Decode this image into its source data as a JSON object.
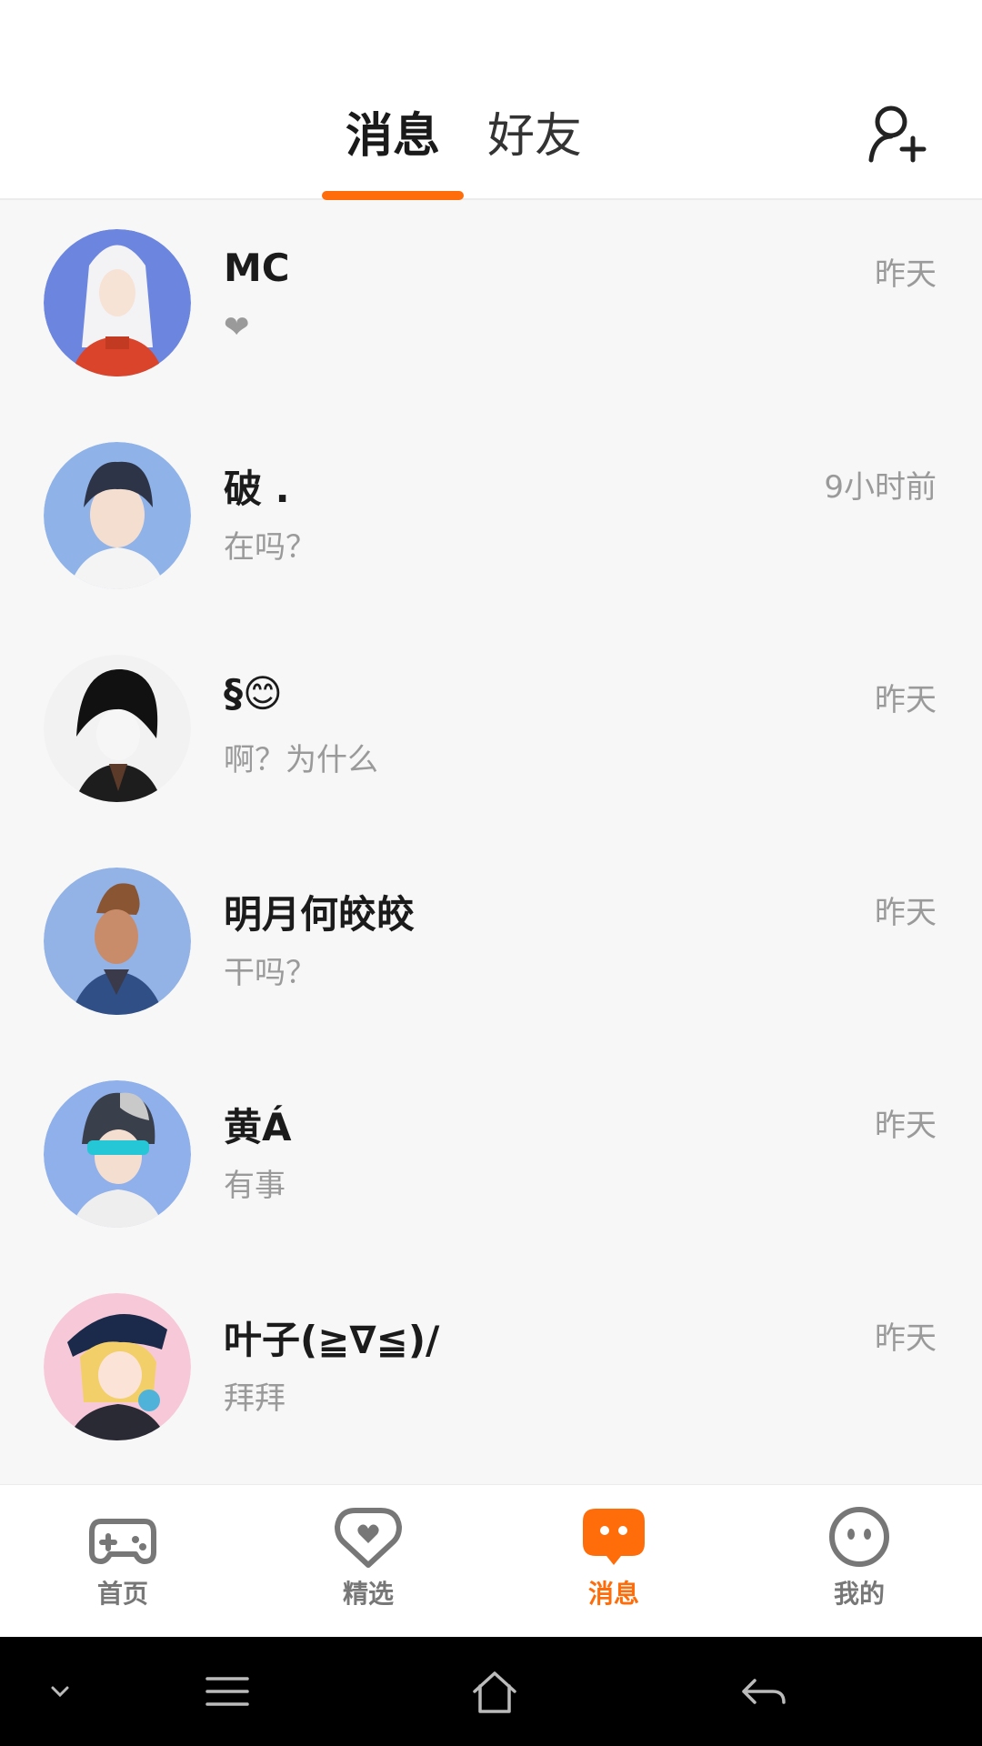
{
  "header": {
    "tabs": [
      {
        "label": "消息",
        "active": true
      },
      {
        "label": "好友",
        "active": false
      }
    ],
    "add_friend_icon": "add-person-icon"
  },
  "conversations": [
    {
      "name": "MC",
      "message": "❤",
      "time": "昨天"
    },
    {
      "name": "破 .",
      "message": "在吗？",
      "time": "9小时前"
    },
    {
      "name": "§😊",
      "message": "啊？为什么",
      "time": "昨天"
    },
    {
      "name": "明月何皎皎",
      "message": "干吗？",
      "time": "昨天"
    },
    {
      "name": "黄Á",
      "message": "有事",
      "time": "昨天"
    },
    {
      "name": "叶子(≧∇≦)/",
      "message": "拜拜",
      "time": "昨天"
    }
  ],
  "bottom_nav": [
    {
      "label": "首页",
      "icon": "gamepad-icon",
      "active": false
    },
    {
      "label": "精选",
      "icon": "heart-badge-icon",
      "active": false
    },
    {
      "label": "消息",
      "icon": "chat-bubble-icon",
      "active": true
    },
    {
      "label": "我的",
      "icon": "face-icon",
      "active": false
    }
  ],
  "colors": {
    "accent": "#ff6d0a",
    "background": "#f7f7f8",
    "muted_text": "#9a9a9a"
  }
}
